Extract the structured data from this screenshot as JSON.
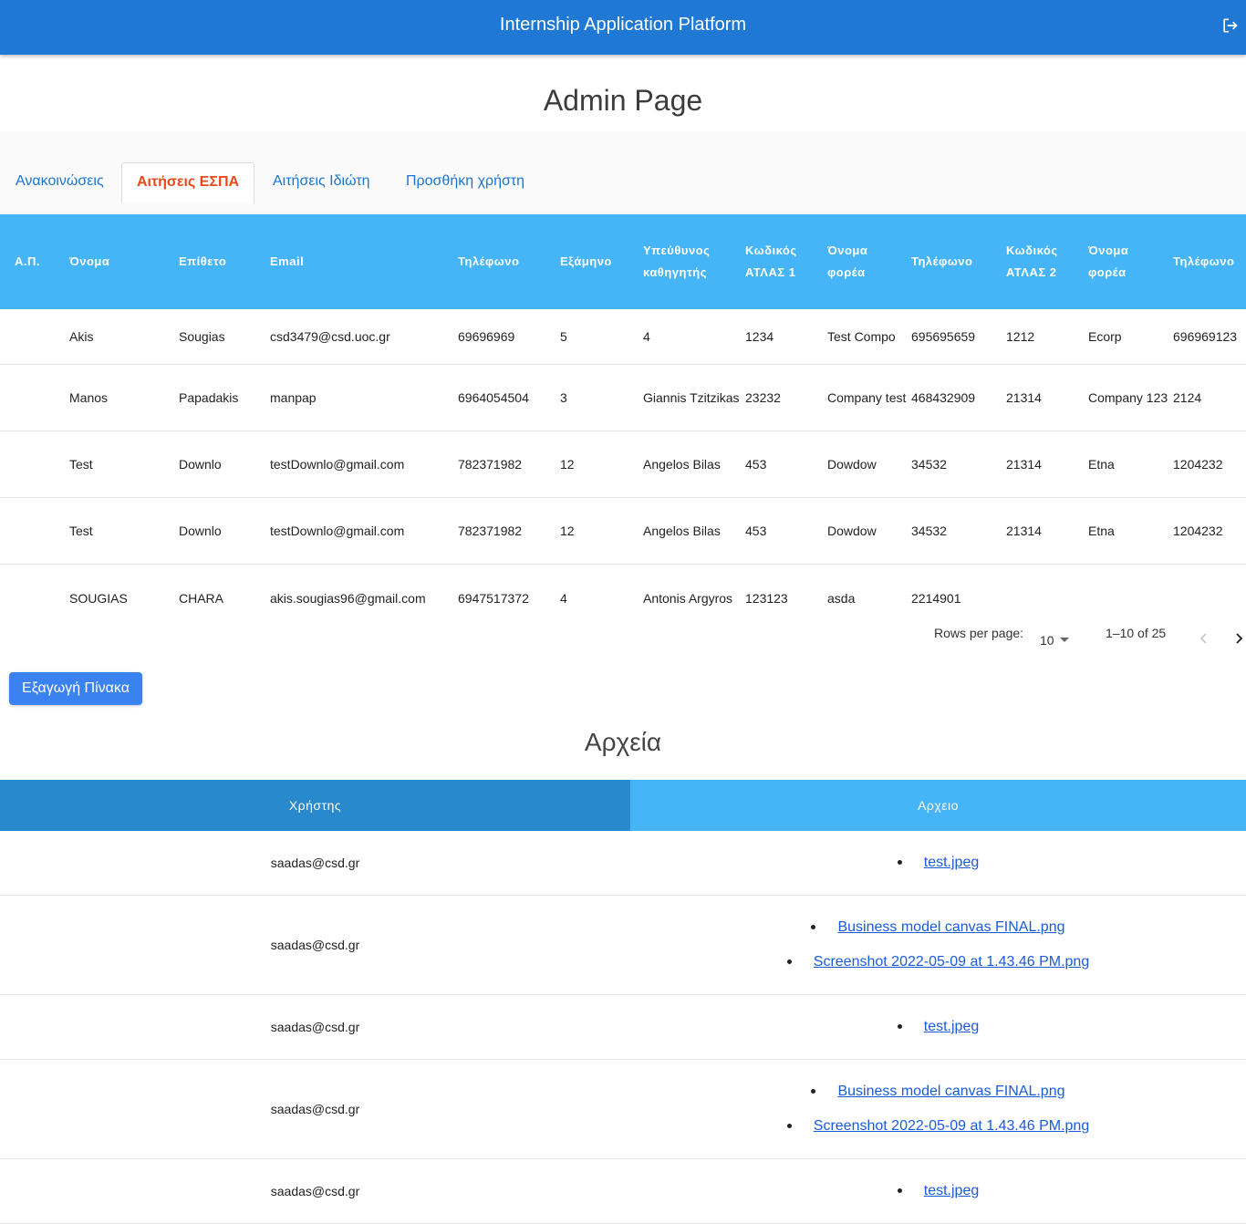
{
  "appbar": {
    "title": "Internship Application Platform",
    "logout_icon": "logout-icon"
  },
  "page": {
    "title": "Admin Page"
  },
  "tabs": [
    {
      "label": "Ανακοινώσεις",
      "active": false
    },
    {
      "label": "Αιτήσεις ΕΣΠΑ",
      "active": true
    },
    {
      "label": "Αιτήσεις Ιδιώτη",
      "active": false
    },
    {
      "label": "Προσθήκη χρήστη",
      "active": false
    }
  ],
  "table": {
    "headers": [
      "Α.Π.",
      "Όνομα",
      "Επίθετο",
      "Email",
      "Τηλέφωνο",
      "Εξάμηνο",
      "Υπεύθυνος καθηγητής",
      "Κωδικός ΑΤΛΑΣ 1",
      "Όνομα φορέα",
      "Τηλέφωνο",
      "Κωδικός ΑΤΛΑΣ 2",
      "Όνομα φορέα",
      "Τηλέφωνο"
    ],
    "rows": [
      [
        "",
        "Akis",
        "Sougias",
        "csd3479@csd.uoc.gr",
        "69696969",
        "5",
        "4",
        "1234",
        "Test Compo",
        "695695659",
        "1212",
        "Ecorp",
        "696969123"
      ],
      [
        "",
        "Manos",
        "Papadakis",
        "manpap",
        "6964054504",
        "3",
        "Giannis Tzitzikas",
        "23232",
        "Company test",
        "468432909",
        "21314",
        "Company 123",
        "2124"
      ],
      [
        "",
        "Test",
        "Downlo",
        "testDownlo@gmail.com",
        "782371982",
        "12",
        "Angelos Bilas",
        "453",
        "Dowdow",
        "34532",
        "21314",
        "Etna",
        "1204232"
      ],
      [
        "",
        "Test",
        "Downlo",
        "testDownlo@gmail.com",
        "782371982",
        "12",
        "Angelos Bilas",
        "453",
        "Dowdow",
        "34532",
        "21314",
        "Etna",
        "1204232"
      ],
      [
        "",
        "SOUGIAS",
        "CHARA",
        "akis.sougias96@gmail.com",
        "6947517372",
        "4",
        "Antonis Argyros",
        "123123",
        "asda",
        "2214901",
        "",
        "",
        ""
      ]
    ]
  },
  "pagination": {
    "rows_per_page_label": "Rows per page:",
    "rows_per_page": "10",
    "range": "1–10 of 25"
  },
  "export_button": "Εξαγωγή Πίνακα",
  "files": {
    "title": "Αρχεία",
    "header_user": "Χρήστης",
    "header_file": "Αρχειο",
    "colors": {
      "user_header": "#2889cc",
      "file_header": "#45b5f8"
    },
    "rows": [
      {
        "user": "saadas@csd.gr",
        "files": [
          "test.jpeg"
        ]
      },
      {
        "user": "saadas@csd.gr",
        "files": [
          "Business model canvas FINAL.png",
          "Screenshot 2022-05-09 at 1.43.46 PM.png"
        ]
      },
      {
        "user": "saadas@csd.gr",
        "files": [
          "test.jpeg"
        ]
      },
      {
        "user": "saadas@csd.gr",
        "files": [
          "Business model canvas FINAL.png",
          "Screenshot 2022-05-09 at 1.43.46 PM.png"
        ]
      },
      {
        "user": "saadas@csd.gr",
        "files": [
          "test.jpeg"
        ]
      }
    ]
  }
}
